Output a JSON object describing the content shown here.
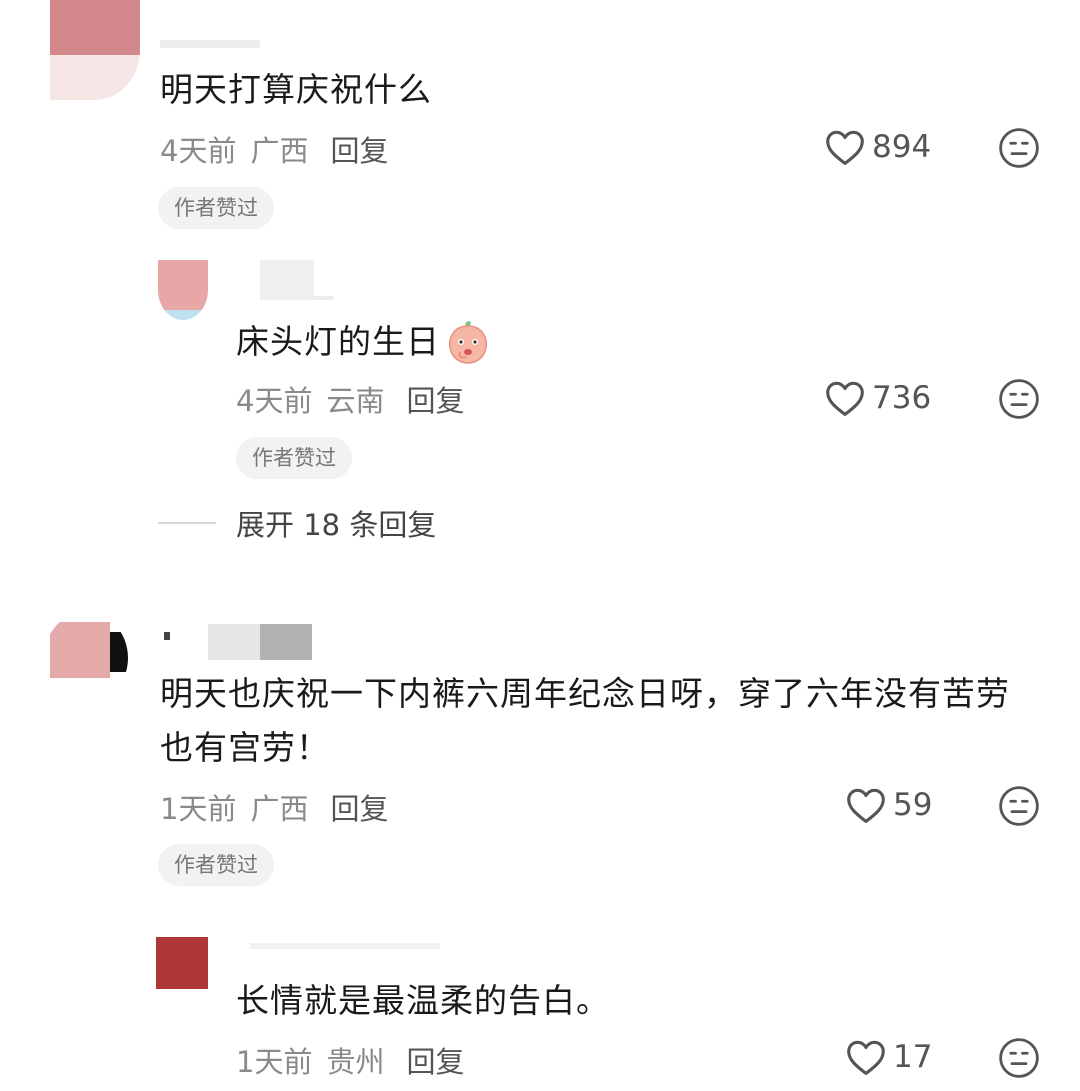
{
  "comments": [
    {
      "text": "明天打算庆祝什么",
      "time": "4天前",
      "location": "广西",
      "reply_label": "回复",
      "likes": "894",
      "badge": "作者赞过",
      "avatar_color": "#d8898c",
      "replies": [
        {
          "text": "床头灯的生日",
          "time": "4天前",
          "location": "云南",
          "reply_label": "回复",
          "likes": "736",
          "badge": "作者赞过",
          "avatar_color": "#e6a7a6",
          "emoji": "peach-face-emoji"
        }
      ],
      "expand_label": "展开 18 条回复"
    },
    {
      "text_line1": "明天也庆祝一下内裤六周年纪念日呀，穿了六年没有苦劳",
      "text_line2": "也有宫劳！",
      "time": "1天前",
      "location": "广西",
      "reply_label": "回复",
      "likes": "59",
      "badge": "作者赞过",
      "avatar_color": "#e3a9a9",
      "replies": [
        {
          "text": "长情就是最温柔的告白。",
          "time": "1天前",
          "location": "贵州",
          "reply_label": "回复",
          "likes": "17",
          "avatar_color": "#b03a36"
        }
      ]
    }
  ],
  "icons": {
    "like": "heart-outline-icon",
    "react": "neutral-face-icon"
  }
}
